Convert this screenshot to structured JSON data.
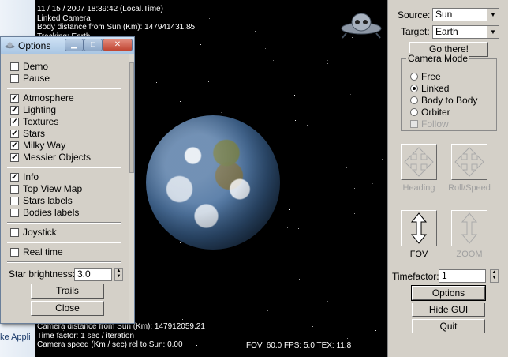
{
  "desktop": {
    "bottom_text": "ke Appli"
  },
  "hud": {
    "line1": "11 / 15 / 2007   18:39:42 (Local Time)",
    "line2": "Linked Camera",
    "line3": "Body distance from Sun (Km): 147941431.85",
    "line4": "Tracking: Earth",
    "bottom1": "Camera distance from Sun (Km): 147912059.21",
    "bottom2": "Time factor: 1 sec / iteration",
    "bottom3": "Camera speed (Km / sec) rel to Sun: 0.00",
    "stats": "FOV: 60.0   FPS: 5.0  TEX: 11.8"
  },
  "gui": {
    "source_label": "Source:",
    "source_value": "Sun",
    "target_label": "Target:",
    "target_value": "Earth",
    "go_button": "Go there!",
    "camera_mode_title": "Camera Mode",
    "modes": [
      "Free",
      "Linked",
      "Body to Body",
      "Orbiter"
    ],
    "selected_mode": "Linked",
    "follow_label": "Follow",
    "heading_label": "Heading",
    "rollspeed_label": "Roll/Speed",
    "fov_label": "FOV",
    "zoom_label": "ZOOM",
    "timefactor_label": "Timefactor:",
    "timefactor_value": "1",
    "options_button": "Options",
    "hide_button": "Hide GUI",
    "quit_button": "Quit"
  },
  "options": {
    "title": "Options",
    "demo": "Demo",
    "pause": "Pause",
    "atmosphere": "Atmosphere",
    "lighting": "Lighting",
    "textures": "Textures",
    "stars": "Stars",
    "milky_way": "Milky Way",
    "messier": "Messier Objects",
    "info": "Info",
    "top_view": "Top View Map",
    "stars_labels": "Stars labels",
    "bodies_labels": "Bodies labels",
    "joystick": "Joystick",
    "real_time": "Real time",
    "star_brightness_label": "Star brightness:",
    "star_brightness_value": "3.0",
    "trails_button": "Trails",
    "close_button": "Close",
    "checked": [
      "atmosphere",
      "lighting",
      "textures",
      "stars",
      "milky_way",
      "messier",
      "info"
    ]
  },
  "colors": {
    "space": "#000000",
    "panel": "#d4d0c8",
    "titlebar": "#a9c6e3"
  }
}
